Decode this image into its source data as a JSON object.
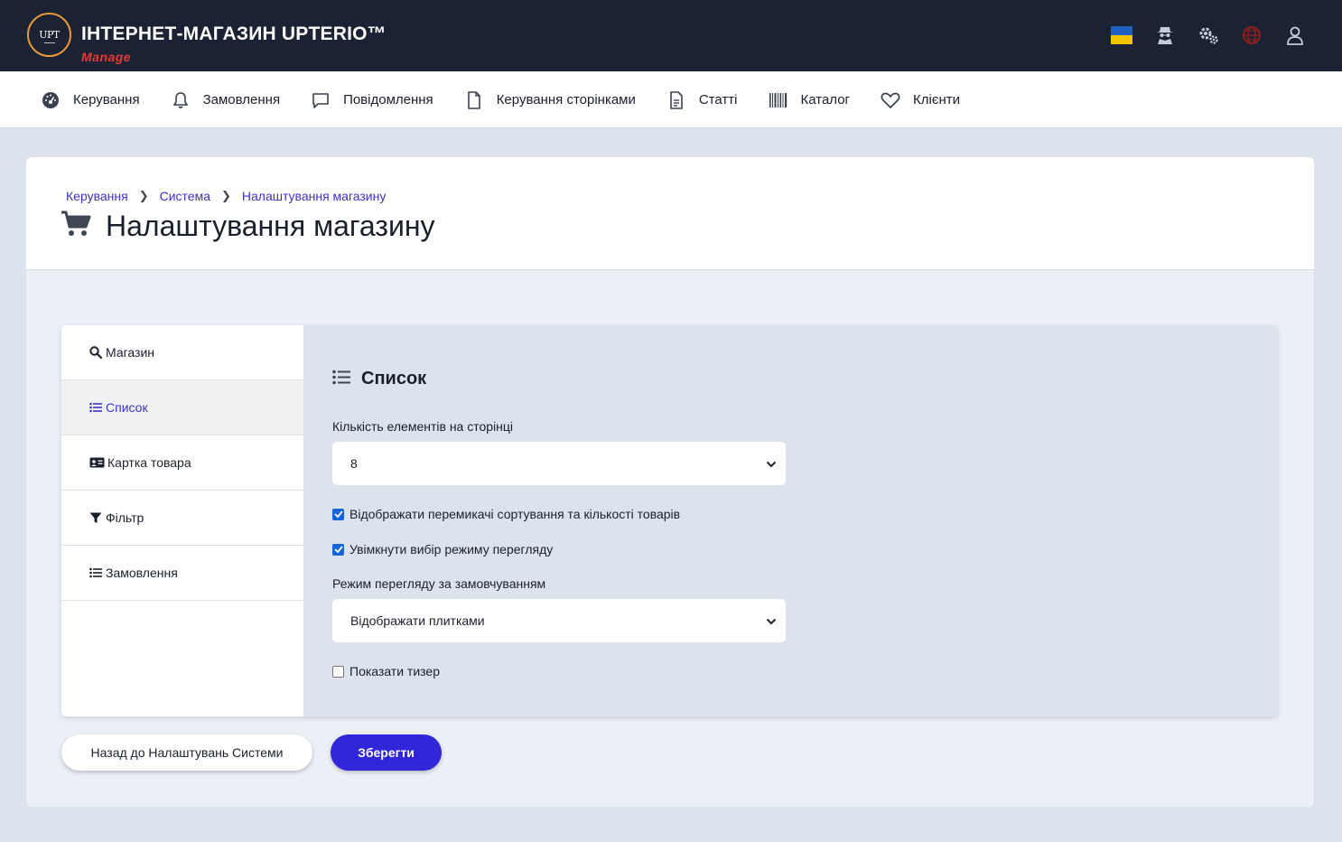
{
  "header": {
    "logo_text": "UPT",
    "title": "ІНТЕРНЕТ-МАГАЗИН UPTERIO™",
    "subtitle": "Manage",
    "icons": [
      "ukraine-flag-icon",
      "spy-agent-icon",
      "gears-icon",
      "globe-icon",
      "user-icon"
    ]
  },
  "nav": {
    "items": [
      {
        "label": "Керування",
        "icon": "dashboard-gauge-icon"
      },
      {
        "label": "Замовлення",
        "icon": "bell-icon"
      },
      {
        "label": "Повідомлення",
        "icon": "message-icon"
      },
      {
        "label": "Керування сторінками",
        "icon": "page-icon"
      },
      {
        "label": "Статті",
        "icon": "document-icon"
      },
      {
        "label": "Каталог",
        "icon": "barcode-icon"
      },
      {
        "label": "Клієнти",
        "icon": "heart-icon"
      }
    ]
  },
  "breadcrumb": [
    "Керування",
    "Система",
    "Налаштування магазину"
  ],
  "page": {
    "title": "Налаштування магазину",
    "title_icon": "shopping-cart-icon"
  },
  "side_menu": [
    {
      "label": "Магазин",
      "icon": "search-icon",
      "active": false
    },
    {
      "label": "Список",
      "icon": "list-icon",
      "active": true
    },
    {
      "label": "Картка товара",
      "icon": "id-card-icon",
      "active": false
    },
    {
      "label": "Фільтр",
      "icon": "filter-icon",
      "active": false
    },
    {
      "label": "Замовлення",
      "icon": "list-icon",
      "active": false
    }
  ],
  "section": {
    "title": "Список",
    "items_per_page_label": "Кількість елементів на сторінці",
    "items_per_page_value": "8",
    "show_sort_switch_label": "Відображати перемикачі сортування та кількості товарів",
    "show_sort_switch_checked": true,
    "enable_view_mode_label": "Увімкнути вибір режиму перегляду",
    "enable_view_mode_checked": true,
    "default_view_label": "Режим перегляду за замовчуванням",
    "default_view_value": "Відображати плитками",
    "show_teaser_label": "Показати тизер",
    "show_teaser_checked": false
  },
  "buttons": {
    "back": "Назад до Налаштувань Системи",
    "save": "Зберегти"
  },
  "colors": {
    "header_bg": "#1b2233",
    "accent": "#3126d8",
    "link": "#3b33c9",
    "subtitle_red": "#e53935"
  }
}
